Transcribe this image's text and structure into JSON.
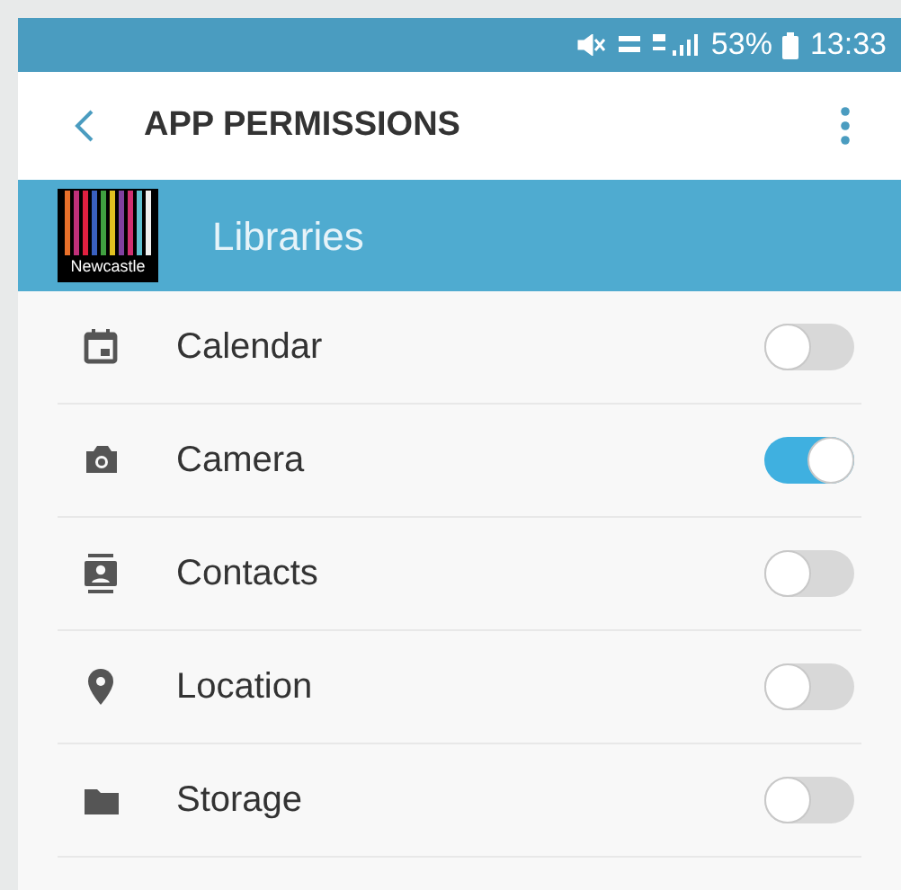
{
  "status_bar": {
    "battery": "53%",
    "time": "13:33"
  },
  "toolbar": {
    "title": "APP PERMISSIONS"
  },
  "app": {
    "logo_text": "Newcastle",
    "name": "Libraries"
  },
  "permissions": [
    {
      "label": "Calendar",
      "on": false
    },
    {
      "label": "Camera",
      "on": true
    },
    {
      "label": "Contacts",
      "on": false
    },
    {
      "label": "Location",
      "on": false
    },
    {
      "label": "Storage",
      "on": false
    }
  ]
}
